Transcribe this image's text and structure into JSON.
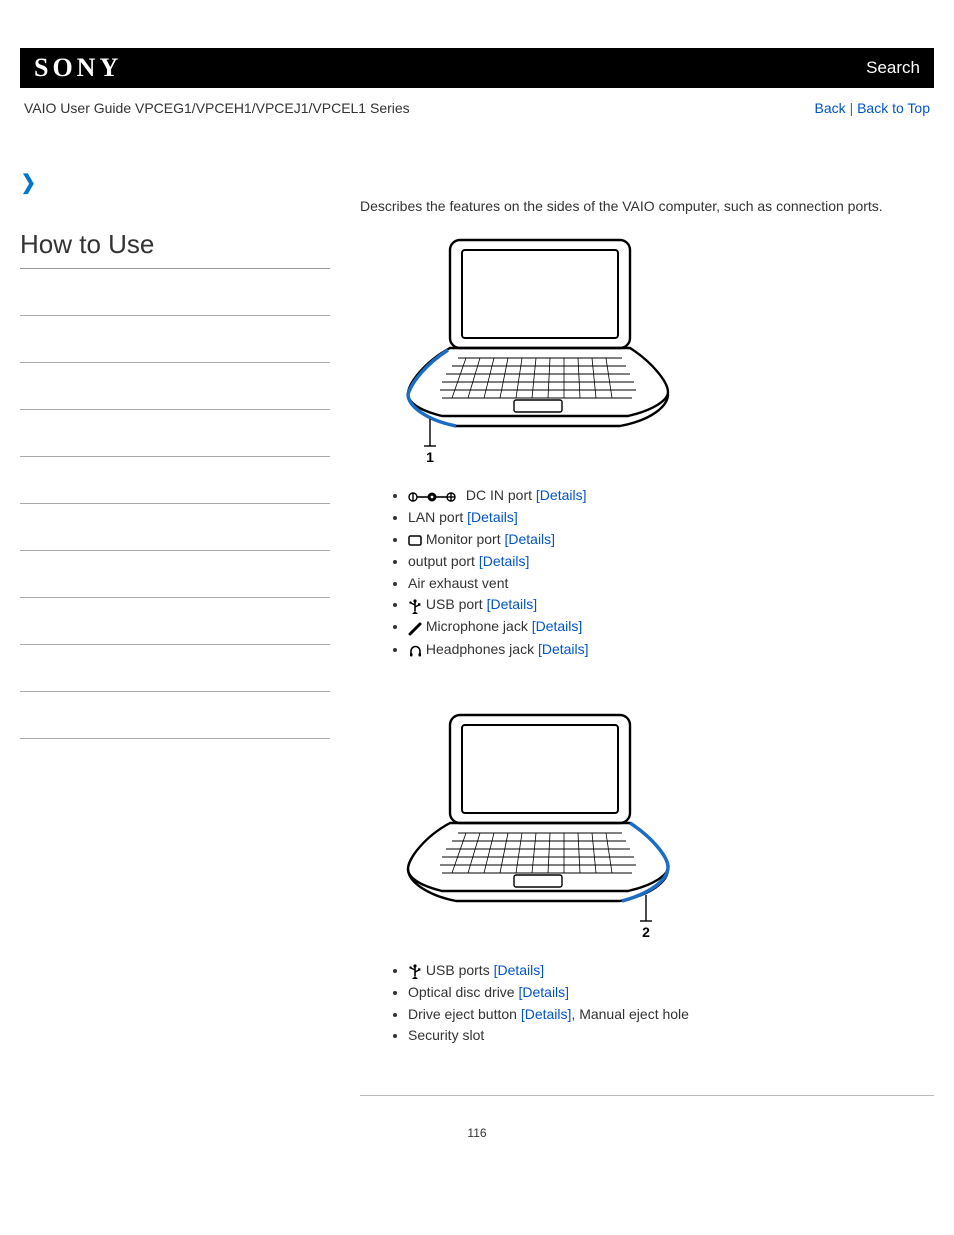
{
  "header": {
    "brand": "SONY",
    "search": "Search",
    "guide_title": "VAIO User Guide VPCEG1/VPCEH1/VPCEJ1/VPCEL1 Series",
    "back": "Back",
    "back_to_top": "Back to Top"
  },
  "sidebar": {
    "title": "How to Use"
  },
  "main": {
    "intro": "Describes the features on the sides of the VAIO computer, such as connection ports."
  },
  "sections": [
    {
      "callout": "1",
      "items": [
        {
          "icon": "dc-in",
          "label": " DC IN port ",
          "link": "[Details]",
          "suffix": ""
        },
        {
          "icon": "",
          "label": "LAN port ",
          "link": "[Details]",
          "suffix": ""
        },
        {
          "icon": "monitor",
          "label": " Monitor port ",
          "link": "[Details]",
          "suffix": ""
        },
        {
          "icon": "",
          "label": "         output port ",
          "link": "[Details]",
          "suffix": ""
        },
        {
          "icon": "",
          "label": "Air exhaust vent",
          "link": "",
          "suffix": ""
        },
        {
          "icon": "usb",
          "label": " USB port ",
          "link": "[Details]",
          "suffix": ""
        },
        {
          "icon": "mic",
          "label": " Microphone jack ",
          "link": "[Details]",
          "suffix": ""
        },
        {
          "icon": "headphones",
          "label": " Headphones jack ",
          "link": "[Details]",
          "suffix": ""
        }
      ]
    },
    {
      "callout": "2",
      "items": [
        {
          "icon": "usb",
          "label": " USB ports ",
          "link": "[Details]",
          "suffix": ""
        },
        {
          "icon": "",
          "label": "Optical disc drive ",
          "link": "[Details]",
          "suffix": ""
        },
        {
          "icon": "",
          "label": "Drive eject button ",
          "link": "[Details]",
          "suffix": ", Manual eject hole"
        },
        {
          "icon": "",
          "label": "Security slot",
          "link": "",
          "suffix": ""
        }
      ]
    }
  ],
  "page_number": "116"
}
